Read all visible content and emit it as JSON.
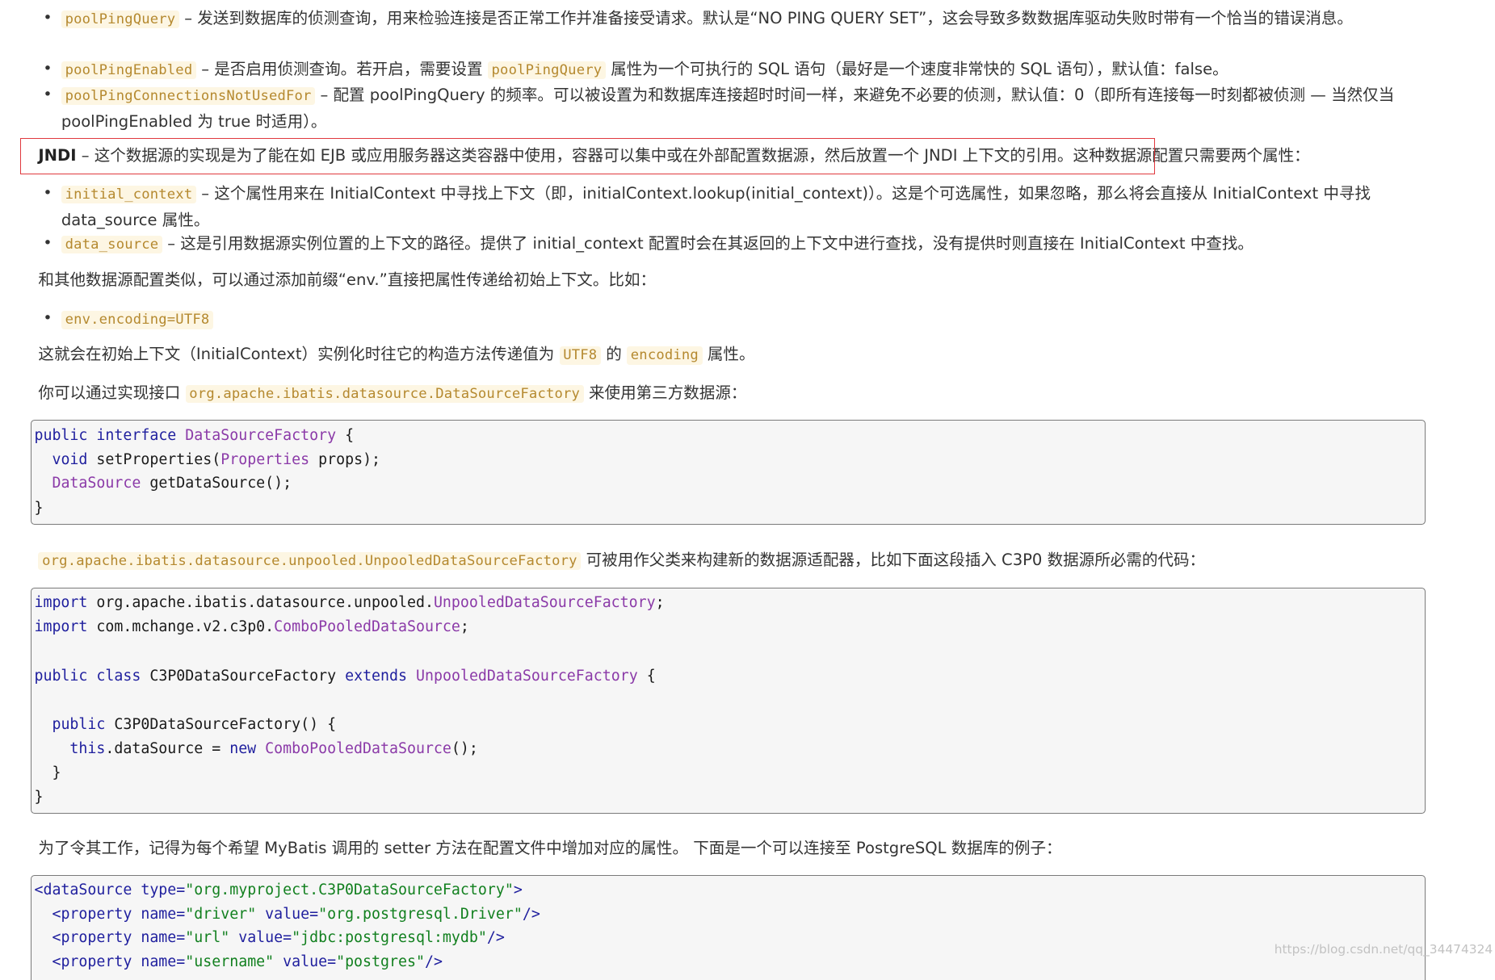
{
  "bullets1": [
    {
      "code": "poolPingQuery",
      "text": " – 发送到数据库的侦测查询，用来检验连接是否正常工作并准备接受请求。默认是“NO PING QUERY SET”，这会导致多数数据库驱动失败时带有一个恰当的错误消息。"
    },
    {
      "code": "poolPingEnabled",
      "pre": " – 是否启用侦测查询。若开启，需要设置 ",
      "code2": "poolPingQuery",
      "post": " 属性为一个可执行的 SQL 语句（最好是一个速度非常快的 SQL 语句），默认值：false。"
    },
    {
      "code": "poolPingConnectionsNotUsedFor",
      "text": " – 配置 poolPingQuery 的频率。可以被设置为和数据库连接超时时间一样，来避免不必要的侦测，默认值：0（即所有连接每一时刻都被侦测 — 当然仅当 poolPingEnabled 为 true 时适用）。"
    }
  ],
  "jndi": {
    "term": "JNDI",
    "text": " – 这个数据源的实现是为了能在如 EJB 或应用服务器这类容器中使用，容器可以集中或在外部配置数据源，然后放置一个 JNDI 上下文的引用。",
    "rest": "这种数据源配置只需要两个属性："
  },
  "bullets2": [
    {
      "code": "initial_context",
      "text": " – 这个属性用来在 InitialContext 中寻找上下文（即，initialContext.lookup(initial_context)）。这是个可选属性，如果忽略，那么将会直接从 InitialContext 中寻找 data_source 属性。"
    },
    {
      "code": "data_source",
      "text": " – 这是引用数据源实例位置的上下文的路径。提供了 initial_context 配置时会在其返回的上下文中进行查找，没有提供时则直接在 InitialContext 中查找。"
    }
  ],
  "para_env": "和其他数据源配置类似，可以通过添加前缀“env.”直接把属性传递给初始上下文。比如：",
  "bullet_env": "env.encoding=UTF8",
  "para_utf8": {
    "a": "这就会在初始上下文（InitialContext）实例化时往它的构造方法传递值为 ",
    "c1": "UTF8",
    "b": " 的 ",
    "c2": "encoding",
    "d": " 属性。"
  },
  "para_factory": {
    "a": "你可以通过实现接口 ",
    "c": "org.apache.ibatis.datasource.DataSourceFactory",
    "b": " 来使用第三方数据源："
  },
  "code1": {
    "l1": [
      "public",
      "interface",
      "DataSourceFactory",
      "{"
    ],
    "l2": [
      "void",
      "setProperties",
      "(",
      "Properties",
      "props",
      ");"
    ],
    "l3": [
      "DataSource",
      "getDataSource",
      "();"
    ],
    "l4": "}"
  },
  "para_unpooled": {
    "c": "org.apache.ibatis.datasource.unpooled.UnpooledDataSourceFactory",
    "b": " 可被用作父类来构建新的数据源适配器，比如下面这段插入 C3P0 数据源所必需的代码："
  },
  "code2": {
    "l1": [
      "import",
      "org.apache.ibatis.datasource.unpooled.",
      "UnpooledDataSourceFactory",
      ";"
    ],
    "l2": [
      "import",
      "com.mchange.v2.c3p0.",
      "ComboPooledDataSource",
      ";"
    ],
    "l3": [
      "public",
      "class",
      "C3P0DataSourceFactory",
      "extends",
      "UnpooledDataSourceFactory",
      "{"
    ],
    "l4": [
      "public",
      "C3P0DataSourceFactory",
      "() {"
    ],
    "l5": [
      "this",
      ".dataSource = ",
      "new",
      "ComboPooledDataSource",
      "();"
    ],
    "l6": "}",
    "l7": "}"
  },
  "para_postgres": "为了令其工作，记得为每个希望 MyBatis 调用的 setter 方法在配置文件中增加对应的属性。 下面是一个可以连接至 PostgreSQL 数据库的例子：",
  "code3": {
    "l1": [
      "<dataSource",
      " type=",
      "\"org.myproject.C3P0DataSourceFactory\"",
      ">"
    ],
    "l2": [
      "<property",
      " name=",
      "\"driver\"",
      " value=",
      "\"org.postgresql.Driver\"",
      "/>"
    ],
    "l3": [
      "<property",
      " name=",
      "\"url\"",
      " value=",
      "\"jdbc:postgresql:mydb\"",
      "/>"
    ],
    "l4": [
      "<property",
      " name=",
      "\"username\"",
      " value=",
      "\"postgres\"",
      "/>"
    ]
  },
  "watermark": "https://blog.csdn.net/qq_34474324"
}
